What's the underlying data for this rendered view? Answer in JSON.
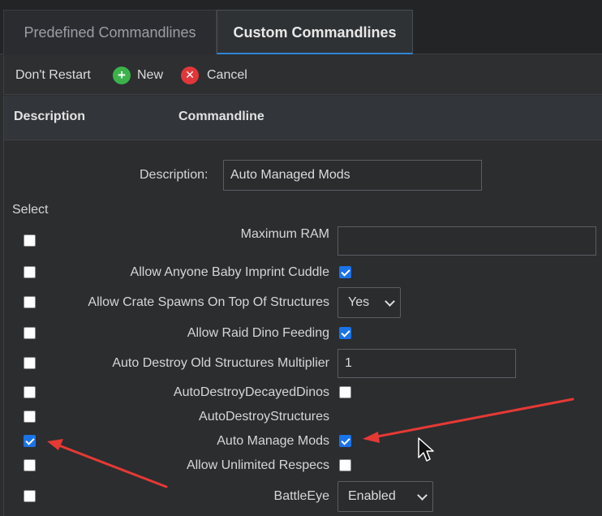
{
  "tabs": [
    {
      "label": "Predefined Commandlines"
    },
    {
      "label": "Custom Commandlines"
    }
  ],
  "toolbar": {
    "dont_restart_label": "Don't Restart",
    "new_label": "New",
    "cancel_label": "Cancel"
  },
  "columns": {
    "description": "Description",
    "commandline": "Commandline"
  },
  "form": {
    "description_label": "Description:",
    "description_value": "Auto Managed Mods",
    "select_label": "Select"
  },
  "options": [
    {
      "label": "Maximum RAM",
      "selected": false,
      "control": "text",
      "value": ""
    },
    {
      "label": "Allow Anyone Baby Imprint Cuddle",
      "selected": false,
      "control": "checkbox",
      "checked": true
    },
    {
      "label": "Allow Crate Spawns On Top Of Structures",
      "selected": false,
      "control": "select",
      "value": "Yes"
    },
    {
      "label": "Allow Raid Dino Feeding",
      "selected": false,
      "control": "checkbox",
      "checked": true
    },
    {
      "label": "Auto Destroy Old Structures Multiplier",
      "selected": false,
      "control": "text",
      "value": "1"
    },
    {
      "label": "AutoDestroyDecayedDinos",
      "selected": false,
      "control": "checkbox",
      "checked": false
    },
    {
      "label": "AutoDestroyStructures",
      "selected": false,
      "control": "none"
    },
    {
      "label": "Auto Manage Mods",
      "selected": true,
      "control": "checkbox",
      "checked": true
    },
    {
      "label": "Allow Unlimited Respecs",
      "selected": false,
      "control": "checkbox",
      "checked": false
    },
    {
      "label": "BattleEye",
      "selected": false,
      "control": "select",
      "value": "Enabled"
    }
  ],
  "colors": {
    "accent": "#2f86d3",
    "annotation_arrow": "#e53935",
    "new_icon": "#3bb34a",
    "cancel_icon": "#e0373a"
  },
  "icons": {
    "new": "plus-circle-icon",
    "cancel": "x-circle-icon",
    "cursor": "mouse-pointer-icon"
  }
}
